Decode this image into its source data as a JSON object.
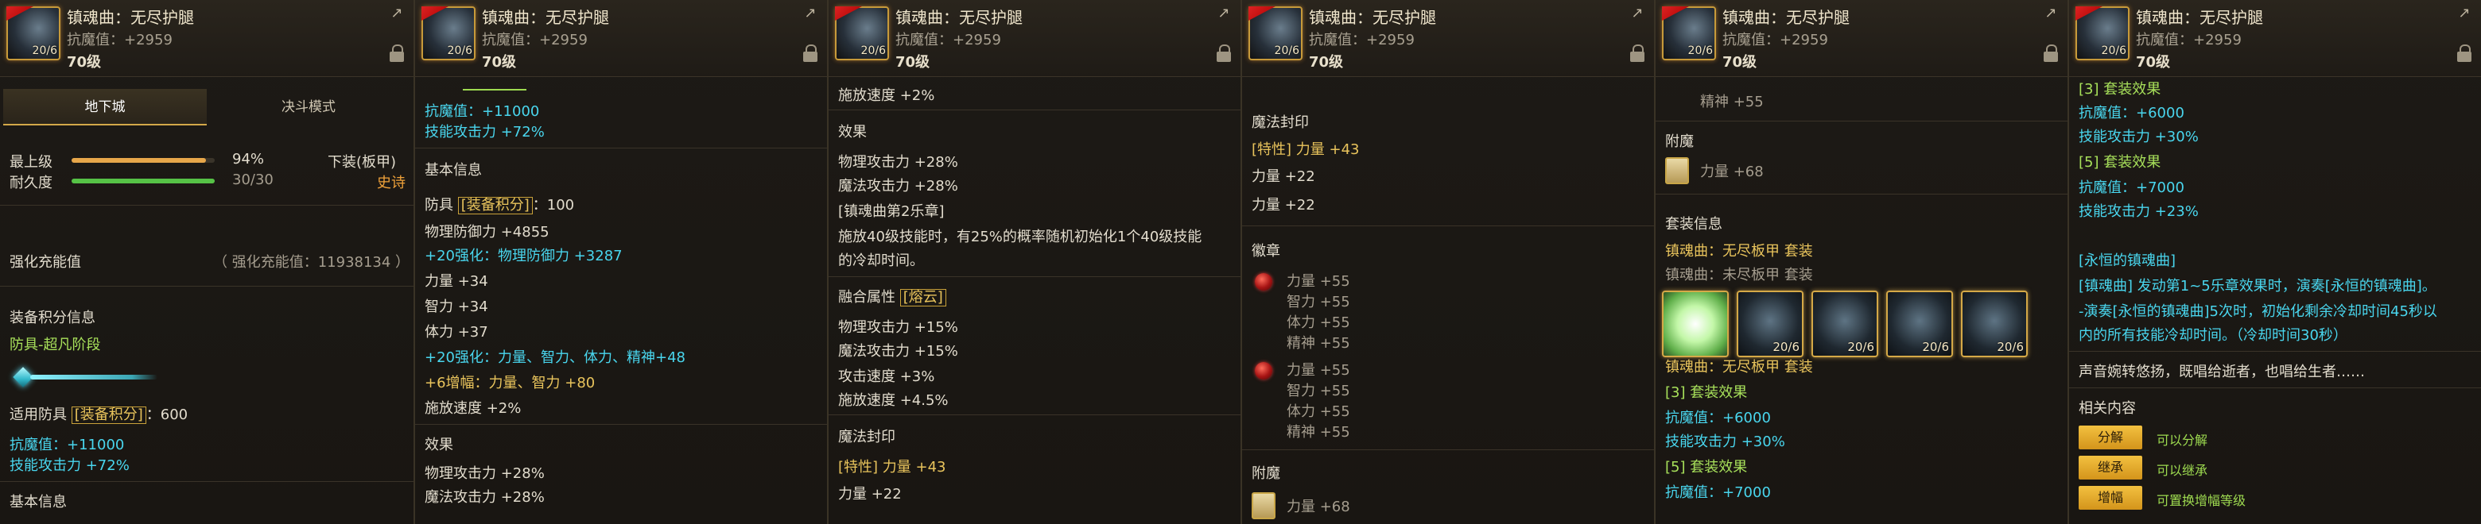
{
  "common": {
    "item_name": "镇魂曲：无尽护腿",
    "anti_magic": "抗魔值：+2959",
    "level": "70级",
    "icon_level": "20/6"
  },
  "p1": {
    "tab_dungeon": "地下城",
    "tab_duel": "决斗模式",
    "max_level_label": "最上级",
    "max_level_pct_text": "94%",
    "max_level_pct": 0.94,
    "durability_label": "耐久度",
    "durability_text": "30/30",
    "durability": 1.0,
    "slot": "下装(板甲)",
    "rarity": "史诗",
    "enhance_label": "强化充能值",
    "enhance_value": "（ 强化充能值：11938134 ）",
    "equip_score_info": "装备积分信息",
    "armor_tier": "防具-超凡阶段",
    "applicable_prefix": "适用防具",
    "equip_score_tag": "[装备积分]",
    "equip_score_suffix": "：600",
    "anti_line": "抗魔值：+11000",
    "skill_atk": "技能攻击力 +72%",
    "basic_info": "基本信息"
  },
  "p2": {
    "anti_line": "抗魔值：+11000",
    "skill_atk": "技能攻击力 +72%",
    "basic_info": "基本信息",
    "armor_prefix": "防具",
    "equip_score_tag": "[装备积分]",
    "armor_suffix": "：100",
    "phys_def": "物理防御力 +4855",
    "enh20_def": "+20强化：物理防御力 +3287",
    "str": "力量 +34",
    "int": "智力 +34",
    "vit": "体力 +37",
    "enh20_stats": "+20强化：力量、智力、体力、精神+48",
    "amp6": "+6增幅：力量、智力 +80",
    "cast_speed": "施放速度 +2%",
    "effect": "效果",
    "phys_atk": "物理攻击力 +28%",
    "mag_atk": "魔法攻击力 +28%"
  },
  "p3": {
    "cast_speed": "施放速度 +2%",
    "effect": "效果",
    "phys_atk": "物理攻击力 +28%",
    "mag_atk": "魔法攻击力 +28%",
    "chapter": "[镇魂曲第2乐章]",
    "desc1": "施放40级技能时，有25%的概率随机初始化1个40级技能",
    "desc2": "的冷却时间。",
    "fusion_prefix": "融合属性",
    "fusion_tag": "[熔云]",
    "f_phys": "物理攻击力 +15%",
    "f_mag": "魔法攻击力 +15%",
    "f_atkspd": "攻击速度 +3%",
    "f_cast": "施放速度 +4.5%",
    "seal": "魔法封印",
    "seal_trait": "[特性] 力量 +43",
    "seal_str": "力量 +22"
  },
  "p4": {
    "seal": "魔法封印",
    "seal_trait_tag": "[特性]",
    "seal_trait_val": "力量 +43",
    "str1": "力量 +22",
    "str2": "力量 +22",
    "emblem": "徽章",
    "e1": [
      "力量 +55",
      "智力 +55",
      "体力 +55",
      "精神 +55"
    ],
    "e2": [
      "力量 +55",
      "智力 +55",
      "体力 +55",
      "精神 +55"
    ],
    "enchant": "附魔",
    "enchant_val": "力量 +68"
  },
  "p5": {
    "spirit": "精神 +55",
    "enchant": "附魔",
    "enchant_val": "力量 +68",
    "set_info": "套装信息",
    "set1_name": "镇魂曲：无尽板甲 套装",
    "set2_name": "镇魂曲：未尽板甲 套装",
    "set_icon_levels": [
      "",
      "20/6",
      "20/6",
      "20/6",
      "20/6"
    ],
    "set3_name": "镇魂曲：无尽板甲 套装",
    "set3_effect": "[3] 套装效果",
    "anti_6000": "抗魔值：+6000",
    "skill_30": "技能攻击力 +30%",
    "set5_effect": "[5] 套装效果",
    "anti_7000": "抗魔值：+7000"
  },
  "p6": {
    "set3_effect": "[3] 套装效果",
    "anti_6000": "抗魔值：+6000",
    "skill_30": "技能攻击力 +30%",
    "set5_effect": "[5] 套装效果",
    "anti_7000": "抗魔值：+7000",
    "skill_23": "技能攻击力 +23%",
    "eternal_title": "[永恒的镇魂曲]",
    "eternal_d1": "[镇魂曲] 发动第1~5乐章效果时，演奏[永恒的镇魂曲]。",
    "eternal_d2": "-演奏[永恒的镇魂曲]5次时，初始化剩余冷却时间45秒以",
    "eternal_d3": "内的所有技能冷却时间。（冷却时间30秒）",
    "flavor": "声音婉转悠扬，既唱给逝者，也唱给生者……",
    "related": "相关内容",
    "buttons": [
      {
        "label": "分解",
        "desc": "可以分解"
      },
      {
        "label": "继承",
        "desc": "可以继承"
      },
      {
        "label": "增幅",
        "desc": "可置换增幅等级"
      }
    ]
  }
}
